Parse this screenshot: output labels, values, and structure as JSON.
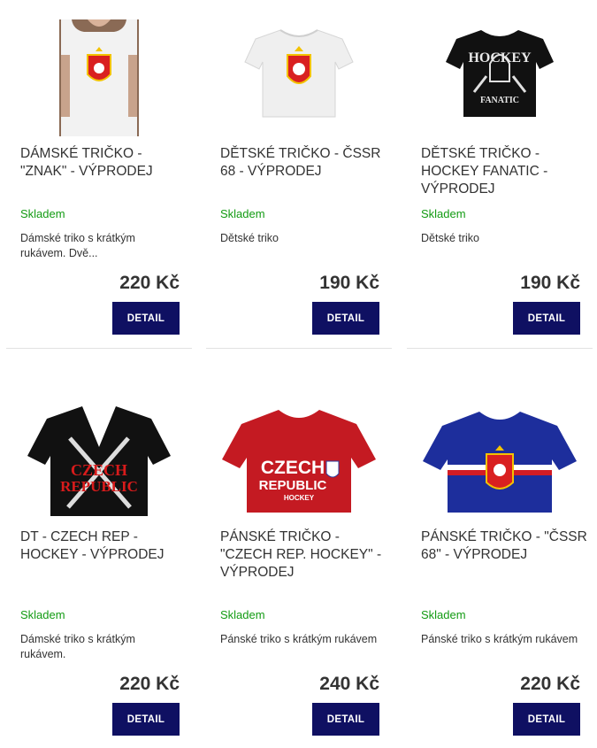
{
  "products": [
    {
      "name": "DÁMSKÉ TRIČKO - \"ZNAK\" - VÝPRODEJ",
      "stock": "Skladem",
      "description": "Dámské triko s krátkým rukávem. Dvě...",
      "price": "220 Kč",
      "button": "DETAIL",
      "shirt_color": "#f2f2f2",
      "print": "czechoslovak-emblem"
    },
    {
      "name": "DĚTSKÉ TRIČKO - ČSSR 68 - VÝPRODEJ",
      "stock": "Skladem",
      "description": "Dětské triko",
      "price": "190 Kč",
      "button": "DETAIL",
      "shirt_color": "#efefef",
      "print": "czechoslovak-emblem"
    },
    {
      "name": "DĚTSKÉ TRIČKO - HOCKEY FANATIC - VÝPRODEJ",
      "stock": "Skladem",
      "description": "Dětské triko",
      "price": "190 Kč",
      "button": "DETAIL",
      "shirt_color": "#111111",
      "print": "hockey-fanatic",
      "print_text": [
        "HOCKEY",
        "FANATIC"
      ]
    },
    {
      "name": "DT - CZECH REP - HOCKEY - VÝPRODEJ",
      "stock": "Skladem",
      "description": "Dámské triko s krátkým rukávem.",
      "price": "220 Kč",
      "button": "DETAIL",
      "shirt_color": "#111111",
      "print": "czech-republic-sticks",
      "print_text": [
        "CZECH",
        "REPUBLIC"
      ]
    },
    {
      "name": "PÁNSKÉ TRIČKO - \"CZECH REP. HOCKEY\" - VÝPRODEJ",
      "stock": "Skladem",
      "description": "Pánské triko s krátkým rukávem",
      "price": "240 Kč",
      "button": "DETAIL",
      "shirt_color": "#c41a22",
      "print": "czech-republic-hockey",
      "print_text": [
        "CZECH",
        "REPUBLIC",
        "HOCKEY"
      ]
    },
    {
      "name": "PÁNSKÉ TRIČKO - \"ČSSR 68\" - VÝPRODEJ",
      "stock": "Skladem",
      "description": "Pánské triko s krátkým rukávem",
      "price": "220 Kč",
      "button": "DETAIL",
      "shirt_color": "#1d2e9c",
      "print": "cssr-68-stripe"
    }
  ]
}
